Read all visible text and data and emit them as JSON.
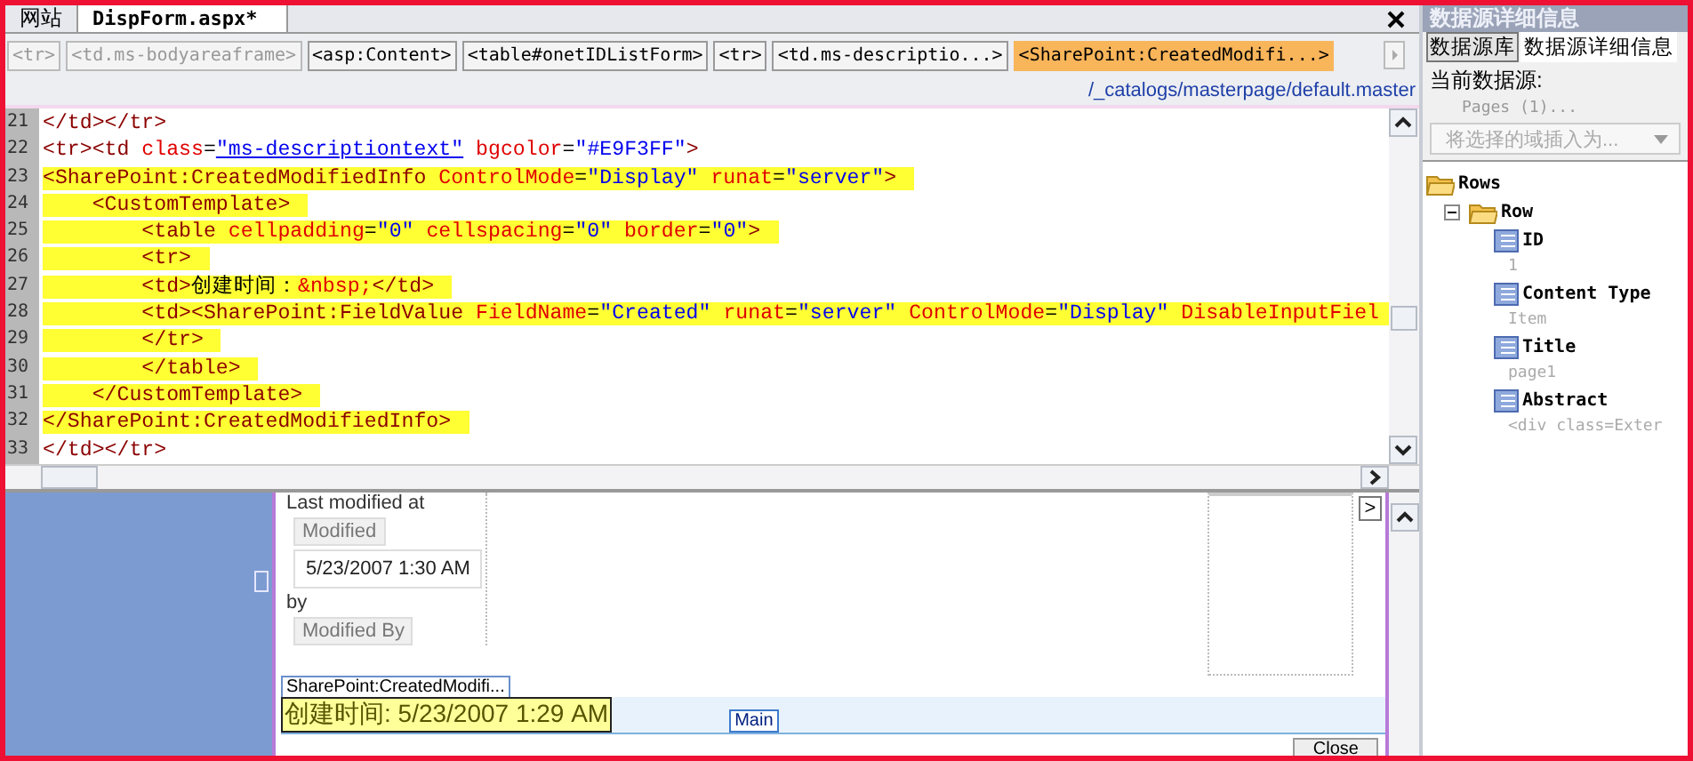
{
  "document_tabs": [
    {
      "label": "网站",
      "selected": false
    },
    {
      "label": "DispForm.aspx*",
      "selected": true
    }
  ],
  "breadcrumb": [
    {
      "label": "<tr>",
      "disabled": true,
      "selected": false
    },
    {
      "label": "<td.ms-bodyareaframe>",
      "disabled": true,
      "selected": false
    },
    {
      "label": "<asp:Content>",
      "disabled": false,
      "selected": false
    },
    {
      "label": "<table#onetIDListForm>",
      "disabled": false,
      "selected": false
    },
    {
      "label": "<tr>",
      "disabled": false,
      "selected": false
    },
    {
      "label": "<td.ms-descriptio...>",
      "disabled": false,
      "selected": false
    },
    {
      "label": "<SharePoint:CreatedModifi...>",
      "disabled": false,
      "selected": true
    }
  ],
  "master_path": "/_catalogs/masterpage/default.master",
  "code_lines": [
    {
      "number": "21",
      "highlighted": false,
      "segments": [
        {
          "kind": "tag",
          "text": "</td></tr>"
        }
      ]
    },
    {
      "number": "22",
      "highlighted": false,
      "segments": [
        {
          "kind": "tag",
          "text": "<tr><td "
        },
        {
          "kind": "attr",
          "text": "class"
        },
        {
          "kind": "text",
          "text": "="
        },
        {
          "kind": "link",
          "text": "\"ms-descriptiontext\""
        },
        {
          "kind": "attr",
          "text": " bgcolor"
        },
        {
          "kind": "text",
          "text": "="
        },
        {
          "kind": "value",
          "text": "\"#E9F3FF\""
        },
        {
          "kind": "tag",
          "text": ">"
        }
      ]
    },
    {
      "number": "23",
      "highlighted": true,
      "segments": [
        {
          "kind": "tag",
          "text": "<SharePoint:CreatedModifiedInfo "
        },
        {
          "kind": "attr",
          "text": "ControlMode"
        },
        {
          "kind": "text",
          "text": "="
        },
        {
          "kind": "value",
          "text": "\"Display\""
        },
        {
          "kind": "attr",
          "text": " runat"
        },
        {
          "kind": "text",
          "text": "="
        },
        {
          "kind": "value",
          "text": "\"server\""
        },
        {
          "kind": "tag",
          "text": ">"
        }
      ]
    },
    {
      "number": "24",
      "highlighted": true,
      "segments": [
        {
          "kind": "tag",
          "text": "    <CustomTemplate>"
        }
      ]
    },
    {
      "number": "25",
      "highlighted": true,
      "segments": [
        {
          "kind": "tag",
          "text": "        <table "
        },
        {
          "kind": "attr",
          "text": "cellpadding"
        },
        {
          "kind": "text",
          "text": "="
        },
        {
          "kind": "value",
          "text": "\"0\""
        },
        {
          "kind": "attr",
          "text": " cellspacing"
        },
        {
          "kind": "text",
          "text": "="
        },
        {
          "kind": "value",
          "text": "\"0\""
        },
        {
          "kind": "attr",
          "text": " border"
        },
        {
          "kind": "text",
          "text": "="
        },
        {
          "kind": "value",
          "text": "\"0\""
        },
        {
          "kind": "tag",
          "text": ">"
        }
      ]
    },
    {
      "number": "26",
      "highlighted": true,
      "segments": [
        {
          "kind": "tag",
          "text": "        <tr>"
        }
      ]
    },
    {
      "number": "27",
      "highlighted": true,
      "segments": [
        {
          "kind": "tag",
          "text": "        <td>"
        },
        {
          "kind": "text",
          "text": "创建时间："
        },
        {
          "kind": "attr",
          "text": "&nbsp;"
        },
        {
          "kind": "tag",
          "text": "</td>"
        }
      ]
    },
    {
      "number": "28",
      "highlighted": true,
      "segments": [
        {
          "kind": "tag",
          "text": "        <td><SharePoint:FieldValue "
        },
        {
          "kind": "attr",
          "text": "FieldName"
        },
        {
          "kind": "text",
          "text": "="
        },
        {
          "kind": "value",
          "text": "\"Created\""
        },
        {
          "kind": "attr",
          "text": " runat"
        },
        {
          "kind": "text",
          "text": "="
        },
        {
          "kind": "value",
          "text": "\"server\""
        },
        {
          "kind": "attr",
          "text": " ControlMode"
        },
        {
          "kind": "text",
          "text": "="
        },
        {
          "kind": "value",
          "text": "\"Display\""
        },
        {
          "kind": "attr",
          "text": " DisableInputFiel"
        }
      ]
    },
    {
      "number": "29",
      "highlighted": true,
      "segments": [
        {
          "kind": "tag",
          "text": "        </tr>"
        }
      ]
    },
    {
      "number": "30",
      "highlighted": true,
      "segments": [
        {
          "kind": "tag",
          "text": "        </table>"
        }
      ]
    },
    {
      "number": "31",
      "highlighted": true,
      "segments": [
        {
          "kind": "tag",
          "text": "    </CustomTemplate>"
        }
      ]
    },
    {
      "number": "32",
      "highlighted": true,
      "segments": [
        {
          "kind": "tag",
          "text": "</SharePoint:CreatedModifiedInfo>"
        }
      ]
    },
    {
      "number": "33",
      "highlighted": false,
      "segments": [
        {
          "kind": "tag",
          "text": "</td></tr>"
        }
      ]
    }
  ],
  "design": {
    "last_modified_label": "Last modified at",
    "modified_field": "Modified",
    "modified_value": "5/23/2007 1:30 AM",
    "by_label": "by",
    "modified_by_field": "Modified By",
    "control_tag": "SharePoint:CreatedModifi...",
    "created_text": "创建时间: 5/23/2007 1:29 AM",
    "region_tag": "Main",
    "close_button": "Close",
    "expand_symbol": ">"
  },
  "panel": {
    "title": "数据源详细信息",
    "tabs": [
      {
        "label": "数据源库",
        "selected": false
      },
      {
        "label": "数据源详细信息",
        "selected": true
      }
    ],
    "current_label": "当前数据源:",
    "current_source": "Pages (1)...",
    "insert_dropdown": {
      "label": "将选择的域插入为...",
      "disabled": true
    },
    "tree": [
      {
        "label": "Rows",
        "kind": "folder",
        "children": [
          {
            "label": "Row",
            "kind": "folder",
            "expanded": true,
            "children": [
              {
                "label": "ID",
                "kind": "field",
                "value": "1"
              },
              {
                "label": "Content Type",
                "kind": "field",
                "value": "Item"
              },
              {
                "label": "Title",
                "kind": "field",
                "value": "page1"
              },
              {
                "label": "Abstract",
                "kind": "field",
                "value": "<div class=Exter"
              }
            ]
          }
        ]
      }
    ]
  }
}
